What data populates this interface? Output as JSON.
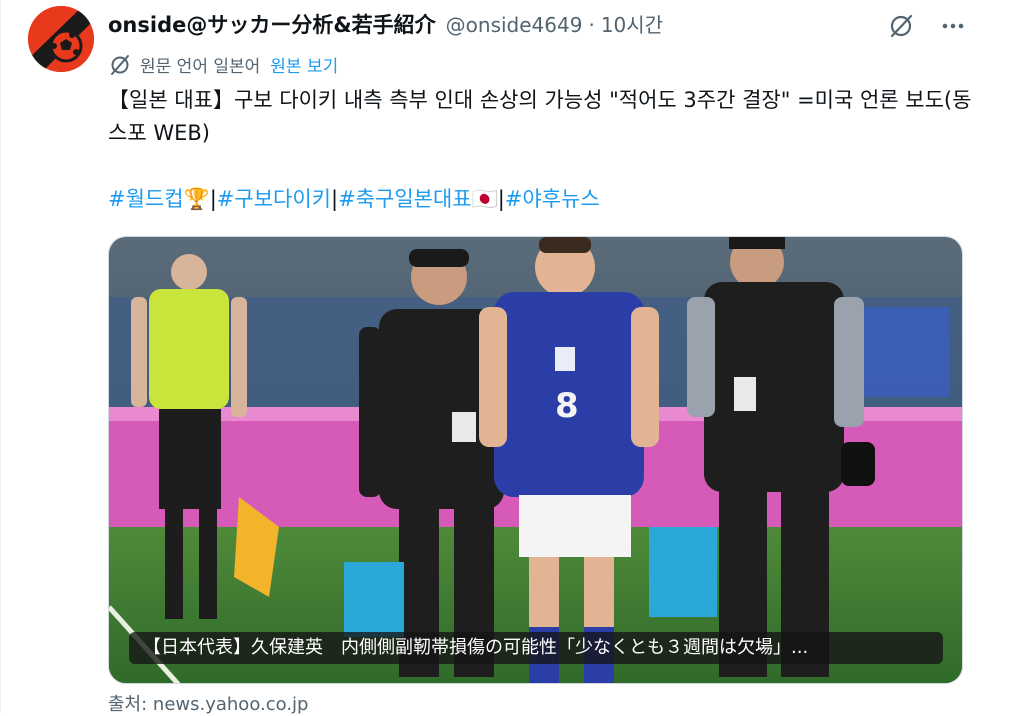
{
  "account": {
    "display_name": "onside@サッカー分析&若手紹介",
    "handle": "@onside4649",
    "separator": "·",
    "time": "10시간"
  },
  "translation": {
    "label": "원문 언어 일본어",
    "link": "원본 보기"
  },
  "tweet": {
    "text": "【일본 대표】구보 다이키 내측 측부 인대 손상의 가능성 \"적어도 3주간 결장\" =미국 언론 보도(동스포 WEB)",
    "hashtags": [
      {
        "text": "#월드컵",
        "emoji": "🏆"
      },
      {
        "text": "#구보다이키",
        "emoji": ""
      },
      {
        "text": "#축구일본대표",
        "emoji": "🇯🇵"
      },
      {
        "text": "#야후뉴스",
        "emoji": ""
      }
    ],
    "hashtag_separator": "|"
  },
  "media": {
    "caption": "【日本代表】久保建英　内側側副靭帯損傷の可能性「少なくとも３週間は欠場」...",
    "jersey_number": "8"
  },
  "source": {
    "text": "출처: news.yahoo.co.jp"
  },
  "icons": {
    "avatar": "soccer-ball-logo",
    "grok": "grok-icon",
    "more": "more-icon",
    "translate": "translate-icon"
  },
  "colors": {
    "accent": "#1d9bf0",
    "secondary_text": "#536471",
    "avatar_bg": "#e8391d"
  }
}
